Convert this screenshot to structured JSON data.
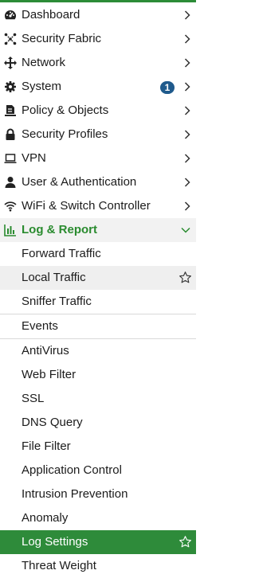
{
  "menu": [
    {
      "label": "Dashboard",
      "icon": "speedometer-icon"
    },
    {
      "label": "Security Fabric",
      "icon": "fabric-icon"
    },
    {
      "label": "Network",
      "icon": "move-arrows-icon"
    },
    {
      "label": "System",
      "icon": "gear-icon",
      "badge": "1"
    },
    {
      "label": "Policy & Objects",
      "icon": "policy-icon"
    },
    {
      "label": "Security Profiles",
      "icon": "lock-icon"
    },
    {
      "label": "VPN",
      "icon": "laptop-icon"
    },
    {
      "label": "User & Authentication",
      "icon": "user-icon"
    },
    {
      "label": "WiFi & Switch Controller",
      "icon": "wifi-icon"
    }
  ],
  "log_group": {
    "label": "Log & Report",
    "icon": "bar-chart-icon"
  },
  "log_items": [
    "Forward Traffic",
    "Local Traffic",
    "Sniffer Traffic",
    "Events",
    "AntiVirus",
    "Web Filter",
    "SSL",
    "DNS Query",
    "File Filter",
    "Application Control",
    "Intrusion Prevention",
    "Anomaly",
    "Log Settings",
    "Threat Weight"
  ],
  "colors": {
    "accent": "#2a8b2f",
    "active_bg": "#2e8b3a",
    "badge": "#1f5a8c"
  }
}
